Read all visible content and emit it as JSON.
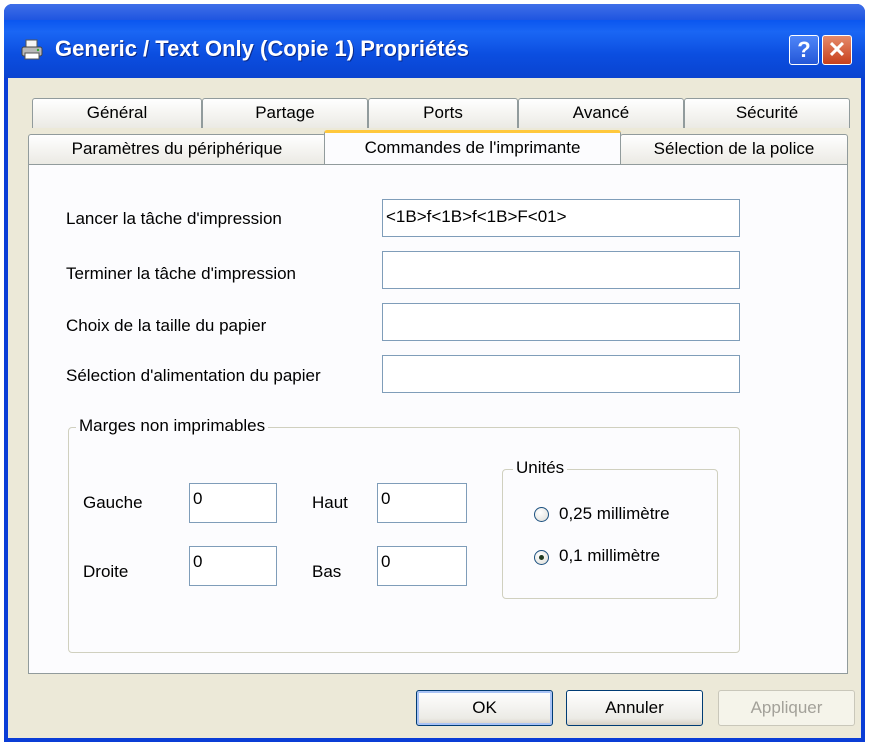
{
  "window": {
    "title": "Generic / Text Only (Copie 1) Propriétés",
    "help_label": "?",
    "close_label": "✕"
  },
  "tabs": {
    "row_back": [
      {
        "label": "Général"
      },
      {
        "label": "Partage"
      },
      {
        "label": "Ports"
      },
      {
        "label": "Avancé"
      },
      {
        "label": "Sécurité"
      }
    ],
    "row_front": [
      {
        "label": "Paramètres du périphérique"
      },
      {
        "label": "Commandes de l'imprimante",
        "active": true
      },
      {
        "label": "Sélection de la police"
      }
    ]
  },
  "form": {
    "start_job": {
      "label": "Lancer la tâche d'impression",
      "value": "<1B>f<1B>f<1B>F<01>"
    },
    "end_job": {
      "label": "Terminer la tâche d'impression",
      "value": ""
    },
    "paper_size": {
      "label": "Choix de la taille du papier",
      "value": ""
    },
    "paper_feed": {
      "label": "Sélection d'alimentation du papier",
      "value": ""
    }
  },
  "margins": {
    "legend": "Marges non imprimables",
    "left": {
      "label": "Gauche",
      "value": "0"
    },
    "top": {
      "label": "Haut",
      "value": "0"
    },
    "right": {
      "label": "Droite",
      "value": "0"
    },
    "bottom": {
      "label": "Bas",
      "value": "0"
    }
  },
  "units": {
    "legend": "Unités",
    "options": [
      {
        "label": "0,25 millimètre",
        "selected": false
      },
      {
        "label": "0,1 millimètre",
        "selected": true
      }
    ]
  },
  "buttons": {
    "ok": "OK",
    "cancel": "Annuler",
    "apply": "Appliquer"
  }
}
